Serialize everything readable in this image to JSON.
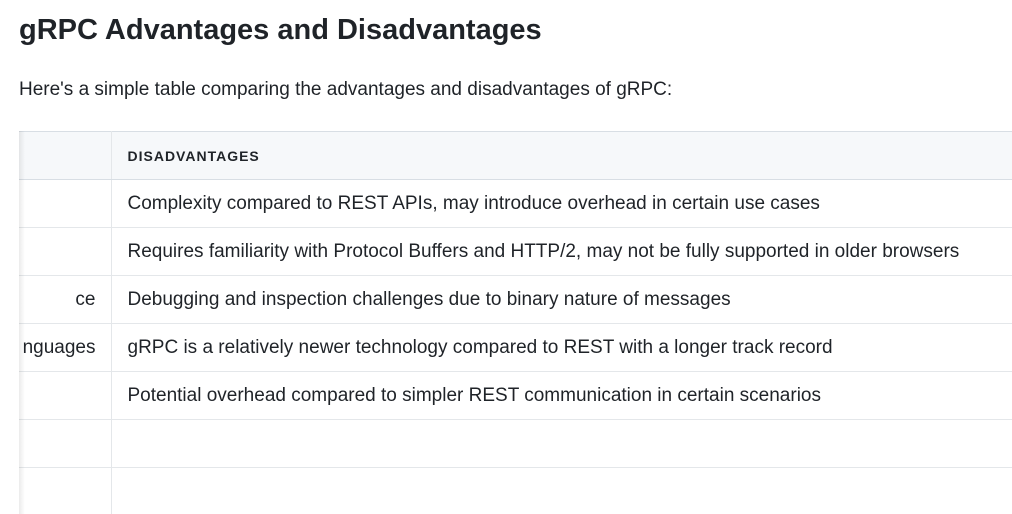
{
  "heading": "gRPC Advantages and Disadvantages",
  "intro": "Here's a simple table comparing the advantages and disadvantages of gRPC:",
  "table": {
    "headers": {
      "advantages": "",
      "disadvantages": "DISADVANTAGES"
    },
    "rows": [
      {
        "advantages": "",
        "disadvantages": "Complexity compared to REST APIs, may introduce overhead in certain use cases"
      },
      {
        "advantages": "",
        "disadvantages": "Requires familiarity with Protocol Buffers and HTTP/2, may not be fully supported in older browsers"
      },
      {
        "advantages": "ce",
        "disadvantages": "Debugging and inspection challenges due to binary nature of messages"
      },
      {
        "advantages": "nguages",
        "disadvantages": "gRPC is a relatively newer technology compared to REST with a longer track record"
      },
      {
        "advantages": "",
        "disadvantages": "Potential overhead compared to simpler REST communication in certain scenarios"
      },
      {
        "advantages": "",
        "disadvantages": ""
      },
      {
        "advantages": "",
        "disadvantages": ""
      }
    ]
  }
}
